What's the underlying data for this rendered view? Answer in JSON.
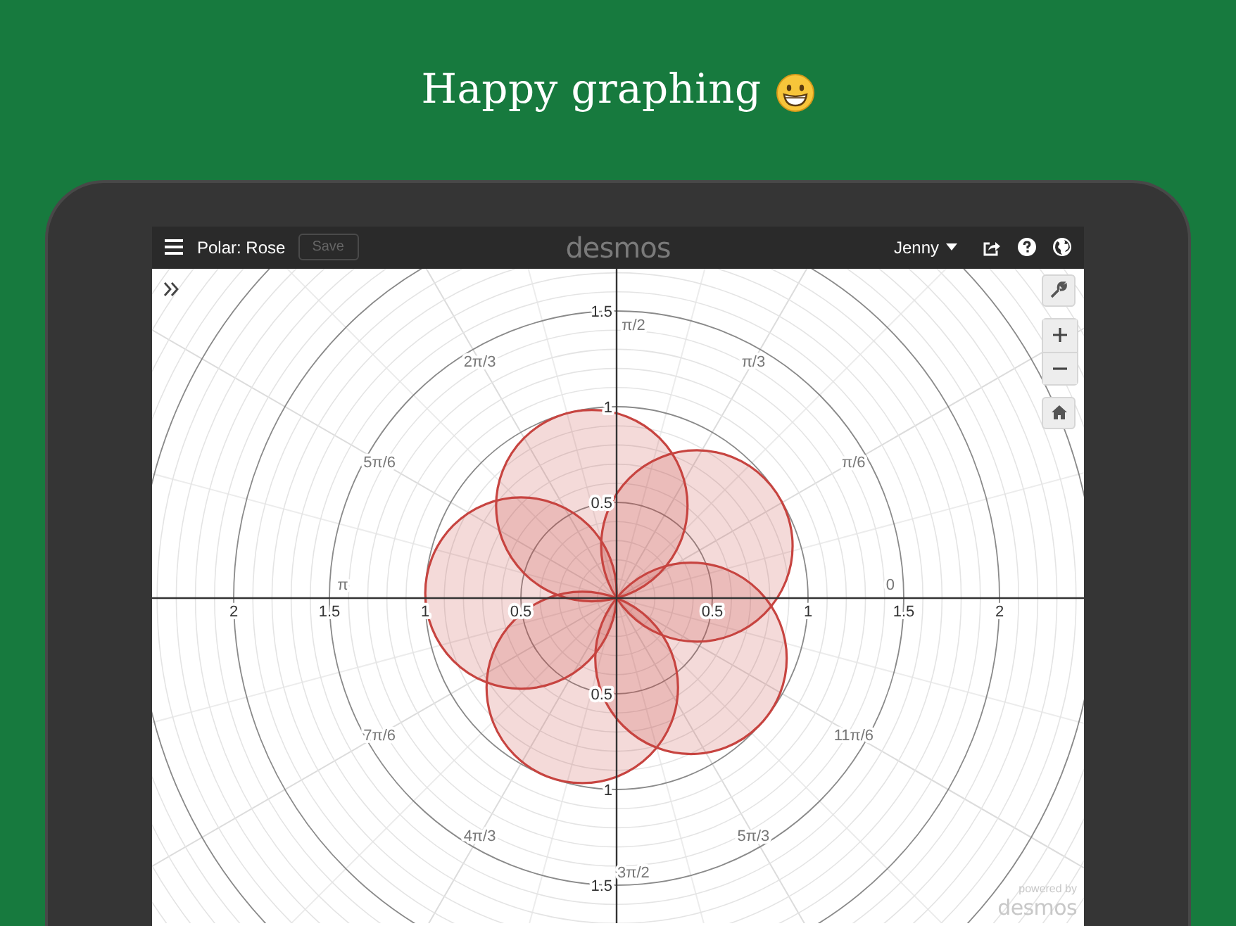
{
  "headline": {
    "text": "Happy graphing"
  },
  "toolbar": {
    "title": "Polar: Rose",
    "save_button": {
      "label": "Save",
      "disabled": true
    },
    "logo": "desmos",
    "user": "Jenny"
  },
  "graph": {
    "x_axis_labels": [
      "2",
      "1.5",
      "1",
      "0.5",
      "0.5",
      "1",
      "1.5",
      "2"
    ],
    "y_axis_labels": [
      "1.5",
      "1",
      "0.5",
      "0.5",
      "1",
      "1.5"
    ],
    "angle_labels": [
      "0",
      "π/6",
      "π/3",
      "π/2",
      "2π/3",
      "5π/6",
      "π",
      "7π/6",
      "4π/3",
      "3π/2",
      "5π/3",
      "11π/6"
    ]
  },
  "branding": {
    "line_1": "powered by",
    "line_2": "desmos"
  }
}
